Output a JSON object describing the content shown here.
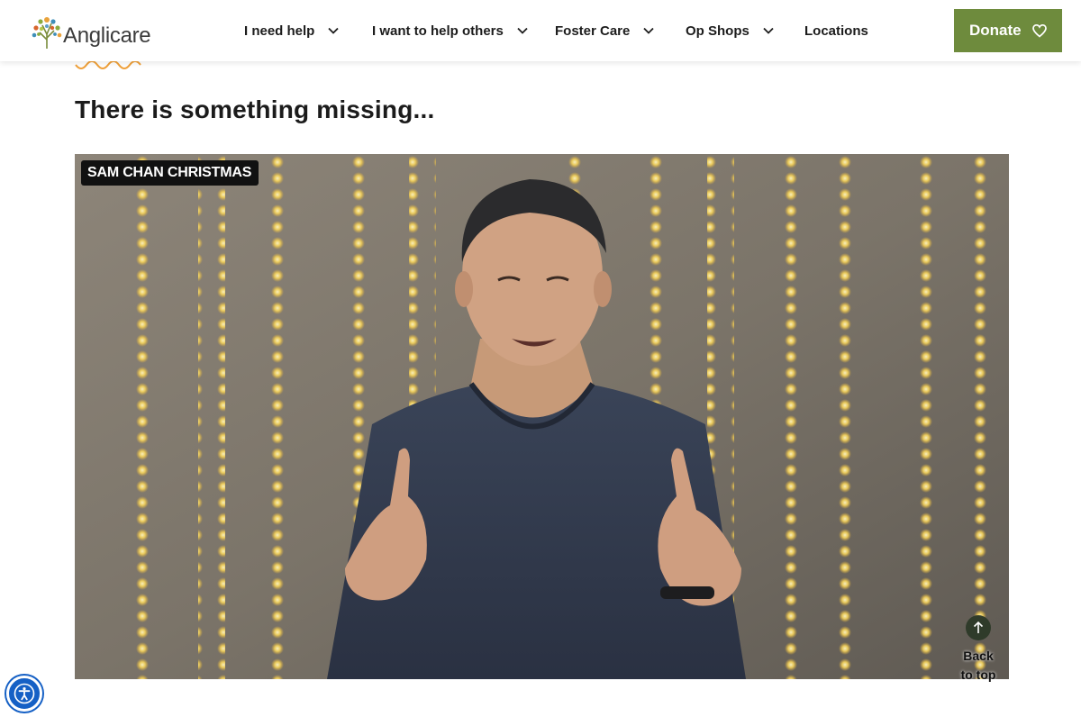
{
  "brand": {
    "name": "Anglicare",
    "logo_icon": "tree-logo-icon",
    "colors": {
      "green": "#6e8b3d",
      "orange": "#f0a13a"
    }
  },
  "nav": {
    "items": [
      {
        "label": "I need help",
        "has_dropdown": true
      },
      {
        "label": "I want to help others",
        "has_dropdown": true
      },
      {
        "label": "Foster Care",
        "has_dropdown": true
      },
      {
        "label": "Op Shops",
        "has_dropdown": true
      },
      {
        "label": "Locations",
        "has_dropdown": false
      }
    ],
    "donate_label": "Donate",
    "donate_icon": "heart-icon"
  },
  "main": {
    "title": "There is something missing...",
    "video": {
      "label": "SAM CHAN CHRISTMAS"
    }
  },
  "back_to_top": {
    "line1": "Back",
    "line2": "to top",
    "icon": "arrow-up-icon"
  },
  "accessibility": {
    "icon": "accessibility-icon"
  }
}
